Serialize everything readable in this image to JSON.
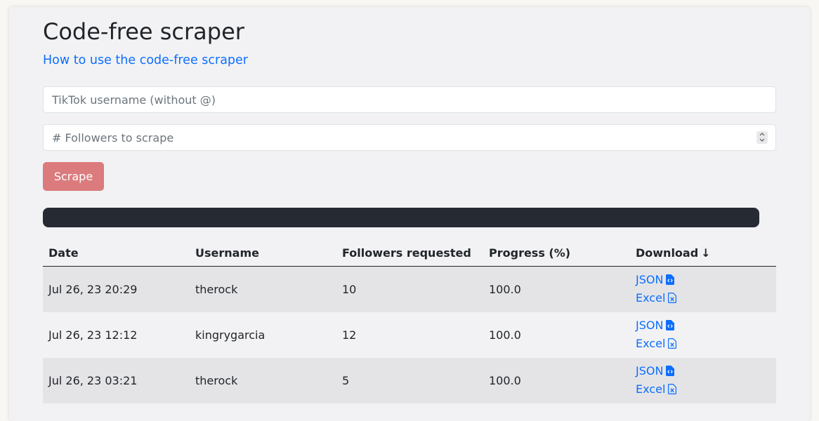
{
  "page": {
    "title": "Code-free scraper",
    "help_link": "How to use the code-free scraper"
  },
  "form": {
    "username_placeholder": "TikTok username (without @)",
    "followers_placeholder": "# Followers to scrape",
    "scrape_label": "Scrape"
  },
  "progress": {
    "percent": 100
  },
  "table": {
    "headers": {
      "date": "Date",
      "username": "Username",
      "followers_requested": "Followers requested",
      "progress": "Progress (%)",
      "download": "Download",
      "sort_indicator": "↓"
    },
    "rows": [
      {
        "date": "Jul 26, 23 20:29",
        "username": "therock",
        "followers_requested": "10",
        "progress": "100.0",
        "json_label": "JSON",
        "excel_label": "Excel"
      },
      {
        "date": "Jul 26, 23 12:12",
        "username": "kingrygarcia",
        "followers_requested": "12",
        "progress": "100.0",
        "json_label": "JSON",
        "excel_label": "Excel"
      },
      {
        "date": "Jul 26, 23 03:21",
        "username": "therock",
        "followers_requested": "5",
        "progress": "100.0",
        "json_label": "JSON",
        "excel_label": "Excel"
      }
    ]
  },
  "icons": {
    "json_file": "file-code-icon",
    "excel_file": "file-excel-icon",
    "sort": "arrow-down-icon"
  },
  "colors": {
    "link": "#0d6efd",
    "scrape_button": "#db7b7e",
    "progress_bar": "#262a33"
  }
}
